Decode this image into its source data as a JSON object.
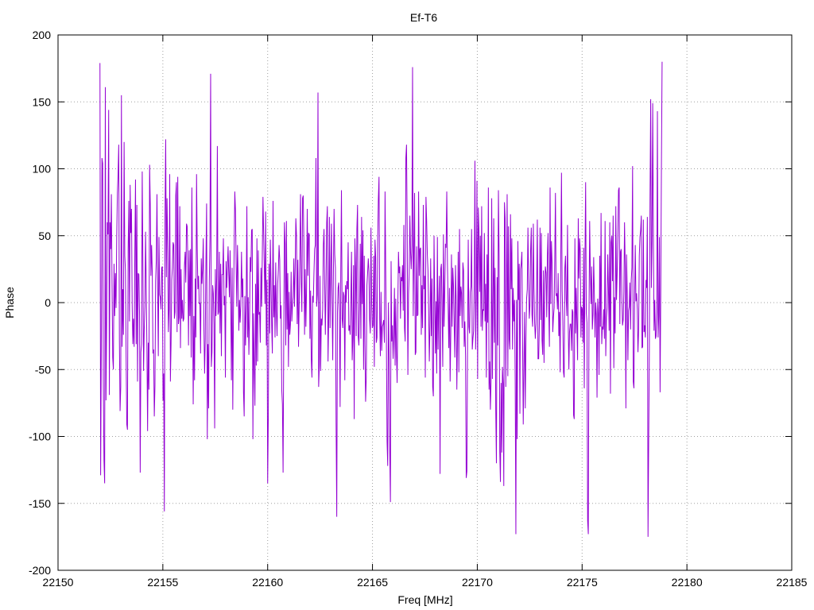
{
  "chart_data": {
    "type": "line",
    "title": "Ef-T6",
    "xlabel": "Freq [MHz]",
    "ylabel": "Phase",
    "xlim": [
      22150,
      22185
    ],
    "ylim": [
      -200,
      200
    ],
    "x_ticks": [
      22150,
      22155,
      22160,
      22165,
      22170,
      22175,
      22180,
      22185
    ],
    "y_ticks": [
      -200,
      -150,
      -100,
      -50,
      0,
      50,
      100,
      150,
      200
    ],
    "grid": true,
    "line_color": "#9400D3",
    "series": [
      {
        "x_start": 22152.0,
        "x_step": 0.032,
        "values": [
          179,
          -129,
          -36,
          108,
          104,
          -59,
          -118,
          -135,
          161,
          -73,
          -12,
          60,
          51,
          144,
          -69,
          60,
          40,
          81,
          14,
          -41,
          -50,
          29,
          -10,
          22,
          -4,
          49,
          82,
          96,
          118,
          -29,
          -81,
          -63,
          155,
          -33,
          10,
          -24,
          120,
          35,
          24,
          -40,
          -91,
          -95,
          40,
          76,
          -14,
          88,
          52,
          70,
          -1,
          -31,
          -12,
          -33,
          38,
          92,
          -31,
          73,
          -59,
          22,
          21,
          -8,
          -127,
          -37,
          -31,
          98,
          31,
          -51,
          -20,
          -3,
          53,
          11,
          -33,
          -96,
          -30,
          -65,
          103,
          74,
          20,
          43,
          22,
          -38,
          -35,
          -85,
          -62,
          16,
          32,
          81,
          12,
          -40,
          49,
          6,
          4,
          -5,
          26,
          27,
          -73,
          -53,
          -156,
          65,
          122,
          19,
          78,
          38,
          -22,
          -5,
          96,
          -59,
          -31,
          17,
          26,
          45,
          43,
          -12,
          -7,
          80,
          90,
          -22,
          94,
          -16,
          -11,
          72,
          -34,
          25,
          -12,
          2,
          -14,
          -12,
          28,
          38,
          15,
          59,
          57,
          31,
          -32,
          39,
          -10,
          40,
          -41,
          86,
          8,
          -76,
          -10,
          -58,
          18,
          -26,
          96,
          40,
          10,
          20,
          -1,
          0,
          -38,
          33,
          14,
          25,
          48,
          -20,
          -53,
          -27,
          32,
          74,
          -102,
          -31,
          -79,
          15,
          49,
          171,
          -48,
          -37,
          13,
          7,
          -16,
          -94,
          25,
          -10,
          19,
          117,
          -9,
          -7,
          38,
          -23,
          29,
          -40,
          21,
          21,
          48,
          -2,
          5,
          -56,
          31,
          11,
          26,
          42,
          21,
          4,
          39,
          -2,
          -58,
          26,
          -80,
          -6,
          38,
          83,
          69,
          29,
          -3,
          43,
          20,
          -21,
          2,
          -15,
          -2,
          38,
          4,
          18,
          -67,
          -85,
          5,
          -32,
          0,
          72,
          -26,
          4,
          -39,
          -12,
          34,
          23,
          54,
          55,
          -102,
          -8,
          -50,
          -77,
          14,
          -47,
          48,
          -44,
          39,
          -9,
          -7,
          -30,
          26,
          -3,
          35,
          79,
          52,
          27,
          -1,
          68,
          -32,
          17,
          -135,
          -84,
          29,
          -23,
          47,
          15,
          -17,
          -38,
          76,
          -11,
          13,
          -26,
          30,
          -7,
          -25,
          14,
          25,
          43,
          32,
          -12,
          -2,
          -65,
          -76,
          -127,
          -24,
          60,
          44,
          -32,
          61,
          -20,
          22,
          -48,
          8,
          -24,
          -16,
          23,
          -14,
          -2,
          4,
          33,
          -3,
          24,
          63,
          50,
          -16,
          32,
          -33,
          -1,
          36,
          81,
          15,
          -7,
          78,
          80,
          45,
          -24,
          25,
          -18,
          11,
          70,
          20,
          52,
          51,
          -27,
          9,
          -42,
          -56,
          5,
          0,
          22,
          40,
          43,
          108,
          -3,
          6,
          157,
          -63,
          -47,
          20,
          -51,
          -12,
          -17,
          -5,
          43,
          55,
          15,
          -24,
          13,
          60,
          72,
          -44,
          -12,
          64,
          -19,
          23,
          59,
          -1,
          -43,
          22,
          70,
          36,
          26,
          -90,
          -160,
          -8,
          11,
          15,
          -8,
          -78,
          24,
          84,
          -12,
          -19,
          8,
          5,
          -58,
          13,
          0,
          16,
          10,
          45,
          -21,
          -17,
          -24,
          2,
          38,
          -43,
          -26,
          28,
          -87,
          48,
          26,
          -25,
          55,
          73,
          -25,
          -32,
          -5,
          44,
          -27,
          64,
          -1,
          54,
          -50,
          35,
          -32,
          -74,
          -56,
          13,
          22,
          33,
          23,
          -13,
          -23,
          56,
          0,
          -19,
          -17,
          35,
          -48,
          47,
          34,
          -30,
          -26,
          46,
          77,
          94,
          -12,
          -40,
          8,
          -36,
          -18,
          -16,
          -13,
          -30,
          83,
          24,
          -29,
          -104,
          -122,
          0,
          -39,
          -110,
          -149,
          31,
          -29,
          -17,
          -42,
          -25,
          11,
          -47,
          3,
          -37,
          -60,
          -4,
          38,
          22,
          27,
          -12,
          19,
          16,
          28,
          -6,
          58,
          -19,
          -29,
          108,
          118,
          55,
          -54,
          6,
          22,
          65,
          38,
          25,
          43,
          176,
          -10,
          41,
          82,
          -39,
          -37,
          42,
          -10,
          -9,
          83,
          20,
          40,
          41,
          -24,
          13,
          -19,
          73,
          10,
          20,
          -56,
          79,
          61,
          36,
          24,
          -5,
          -44,
          -16,
          33,
          -25,
          18,
          -63,
          -70,
          50,
          3,
          -38,
          1,
          -53,
          49,
          -35,
          -1,
          20,
          -128,
          25,
          29,
          -5,
          -48,
          51,
          -18,
          8,
          44,
          41,
          83,
          29,
          -1,
          -34,
          11,
          -59,
          -23,
          36,
          -18,
          26,
          13,
          -16,
          -41,
          28,
          1,
          -65,
          -25,
          38,
          -52,
          55,
          -10,
          12,
          7,
          -19,
          30,
          24,
          -33,
          -14,
          -40,
          -131,
          -126,
          -28,
          47,
          -18,
          -23,
          8,
          12,
          55,
          -35,
          -27,
          -21,
          16,
          106,
          -35,
          4,
          91,
          -57,
          71,
          54,
          8,
          50,
          -18,
          72,
          -21,
          -5,
          -6,
          52,
          -14,
          14,
          -56,
          36,
          -15,
          86,
          -65,
          -44,
          -80,
          -59,
          78,
          -57,
          -1,
          63,
          -30,
          26,
          -80,
          -120,
          19,
          -32,
          84,
          35,
          -111,
          -134,
          -60,
          -112,
          -48,
          -61,
          -137,
          75,
          63,
          -63,
          14,
          81,
          -55,
          57,
          -27,
          -35,
          66,
          10,
          48,
          -35,
          11,
          -14,
          2,
          -59,
          -173,
          2,
          -102,
          46,
          2,
          29,
          -83,
          25,
          29,
          38,
          -29,
          -91,
          -47,
          -7,
          -79,
          -29,
          3,
          10,
          56,
          16,
          -12,
          -2,
          39,
          56,
          -9,
          -18,
          59,
          11,
          -15,
          -27,
          -16,
          12,
          62,
          -42,
          -42,
          -16,
          56,
          -13,
          52,
          -28,
          -39,
          24,
          -45,
          14,
          27,
          22,
          -11,
          35,
          52,
          -3,
          -33,
          86,
          -1,
          46,
          30,
          -22,
          -11,
          -4,
          32,
          82,
          5,
          7,
          -5,
          22,
          -25,
          -7,
          -52,
          36,
          97,
          9,
          -14,
          -52,
          -56,
          26,
          35,
          3,
          -10,
          58,
          -14,
          -50,
          -22,
          -16,
          -16,
          -36,
          -5,
          -7,
          -84,
          -87,
          48,
          -23,
          11,
          -16,
          -43,
          63,
          18,
          48,
          39,
          -26,
          -3,
          -5,
          -30,
          41,
          -64,
          31,
          90,
          -8,
          -15,
          -163,
          -173,
          -12,
          61,
          23,
          -1,
          27,
          -20,
          -9,
          34,
          6,
          -26,
          0,
          -9,
          -71,
          3,
          -8,
          -54,
          35,
          -18,
          67,
          -31,
          -18,
          -20,
          -5,
          -27,
          61,
          -40,
          -11,
          -4,
          36,
          11,
          -21,
          60,
          -68,
          45,
          50,
          16,
          65,
          -49,
          4,
          -23,
          72,
          2,
          21,
          50,
          84,
          86,
          -16,
          38,
          40,
          4,
          -17,
          -13,
          8,
          60,
          26,
          -79,
          36,
          7,
          -43,
          -6,
          -3,
          15,
          -20,
          17,
          26,
          102,
          -59,
          -64,
          2,
          43,
          1,
          7,
          -5,
          -37,
          -21,
          35,
          49,
          54,
          65,
          -34,
          -33,
          62,
          -22,
          -17,
          -26,
          17,
          11,
          64,
          -175,
          -103,
          -34,
          77,
          152,
          11,
          46,
          149,
          49,
          -21,
          2,
          -27,
          -25,
          -7,
          143,
          -26,
          -10,
          49,
          -67,
          9,
          104,
          180
        ]
      }
    ]
  }
}
